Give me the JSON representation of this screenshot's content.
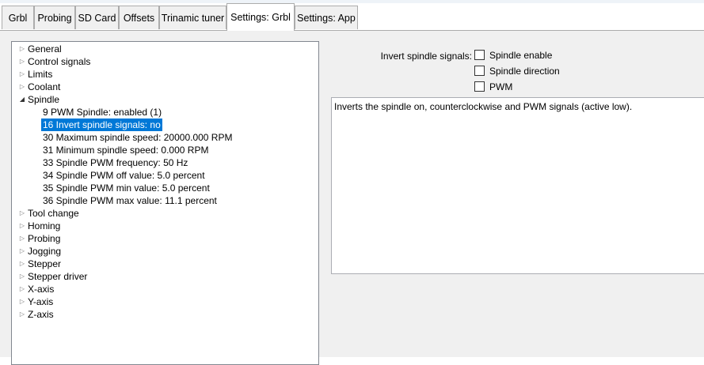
{
  "tabs": [
    {
      "label": "Grbl"
    },
    {
      "label": "Probing"
    },
    {
      "label": "SD Card"
    },
    {
      "label": "Offsets"
    },
    {
      "label": "Trinamic tuner"
    },
    {
      "label": "Settings: Grbl",
      "active": true
    },
    {
      "label": "Settings: App"
    }
  ],
  "tree": {
    "groups_before": [
      "General",
      "Control signals",
      "Limits",
      "Coolant"
    ],
    "expanded_group": "Spindle",
    "spindle_items": [
      "9  PWM Spindle: enabled (1)",
      "16  Invert spindle signals: no",
      "30  Maximum spindle speed: 20000.000  RPM",
      "31  Minimum spindle speed: 0.000  RPM",
      "33  Spindle PWM frequency: 50  Hz",
      "34  Spindle PWM off value: 5.0  percent",
      "35  Spindle PWM min value: 5.0  percent",
      "36  Spindle PWM max value: 11.1  percent"
    ],
    "groups_after": [
      "Tool change",
      "Homing",
      "Probing",
      "Jogging",
      "Stepper",
      "Stepper driver",
      "X-axis",
      "Y-axis",
      "Z-axis"
    ]
  },
  "setting": {
    "label": "Invert spindle signals:",
    "options": [
      {
        "label": "Spindle enable",
        "checked": false
      },
      {
        "label": "Spindle direction",
        "checked": false
      },
      {
        "label": "PWM",
        "checked": false
      }
    ],
    "description": "Inverts the spindle on, counterclockwise and PWM signals (active low)."
  },
  "colors": {
    "selection": "#0078d7",
    "panel_bg": "#f0f0f0"
  }
}
